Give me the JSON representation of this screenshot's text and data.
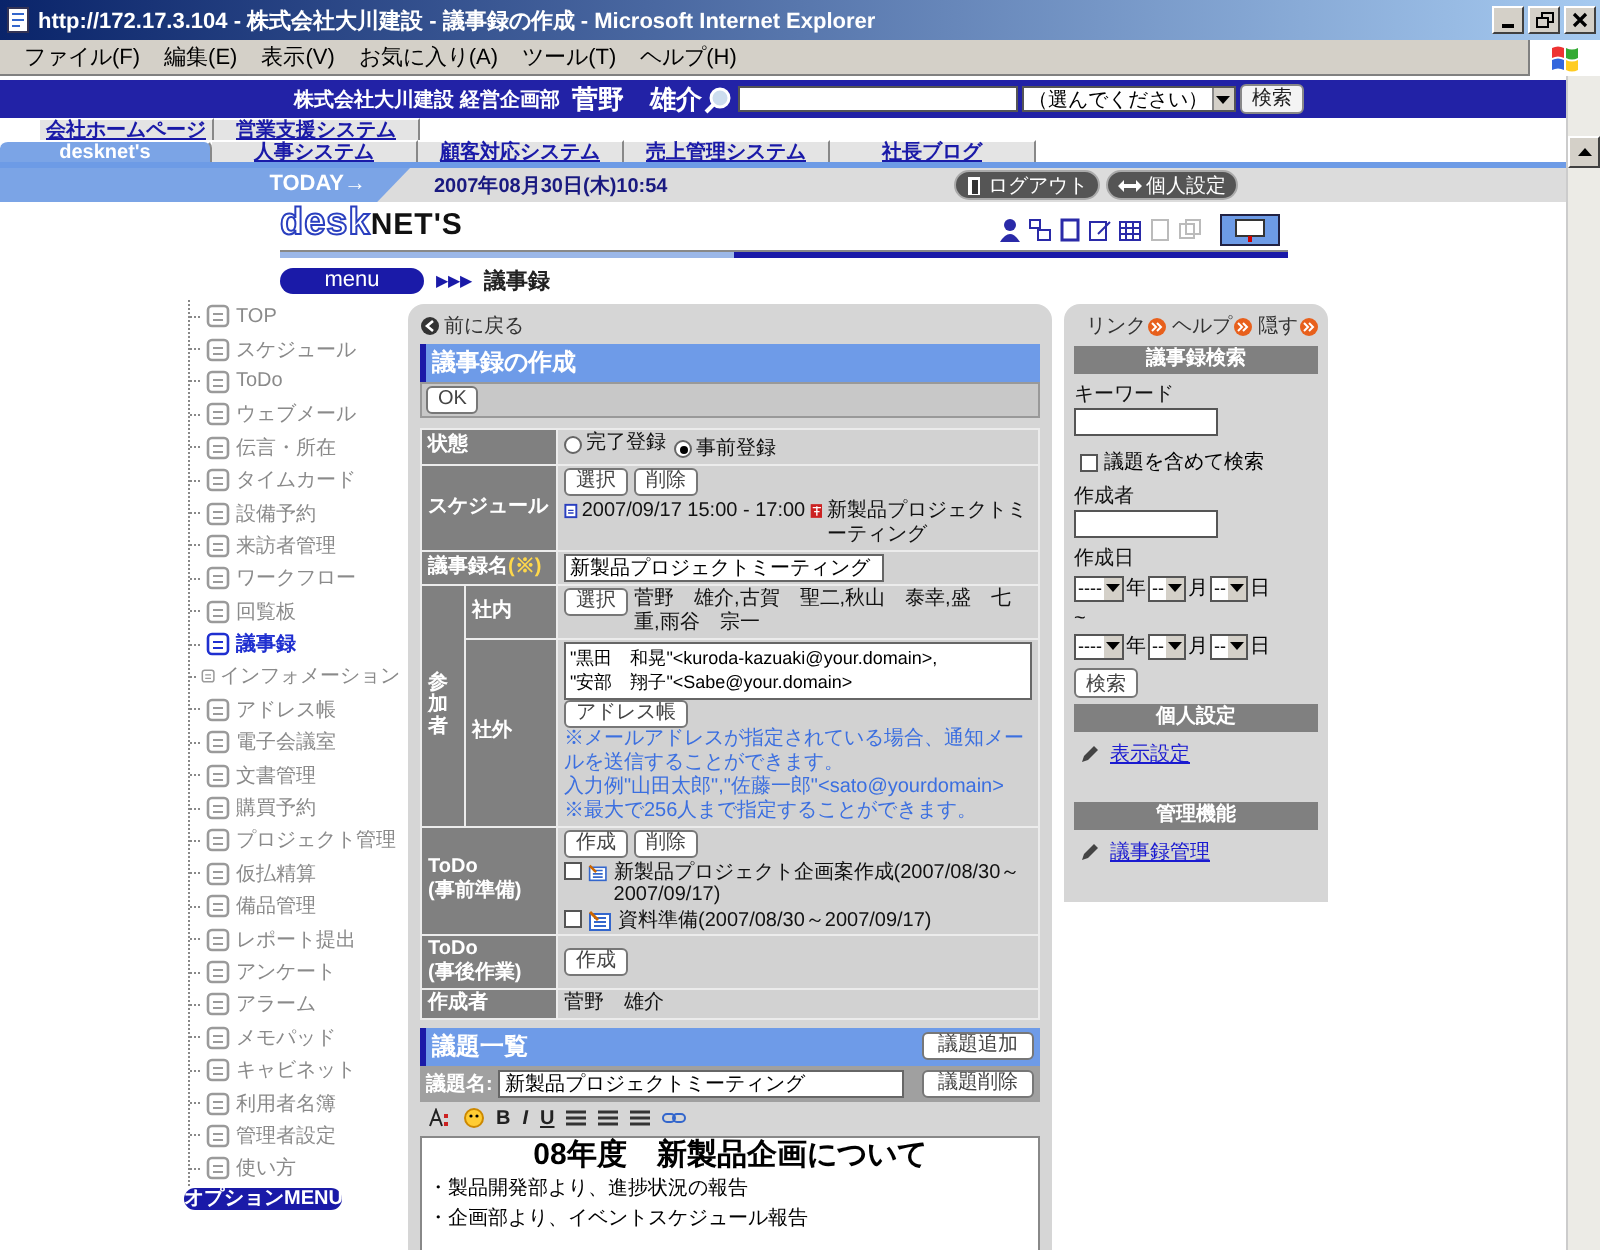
{
  "window": {
    "title": "http://172.17.3.104 - 株式会社大川建設 - 議事録の作成 - Microsoft Internet Explorer"
  },
  "menu_bar": [
    "ファイル(F)",
    "編集(E)",
    "表示(V)",
    "お気に入り(A)",
    "ツール(T)",
    "ヘルプ(H)"
  ],
  "header": {
    "company": "株式会社大川建設 経営企画部",
    "user": "菅野　雄介",
    "search_select": "（選んでください）",
    "search_button": "検索"
  },
  "tabs_top": [
    {
      "label": "会社ホームページ",
      "selected": false
    },
    {
      "label": "営業支援システム",
      "selected": false
    }
  ],
  "tabs_bottom": [
    {
      "label": "desknet's",
      "selected": true
    },
    {
      "label": "人事システム",
      "selected": false
    },
    {
      "label": "顧客対応システム",
      "selected": false
    },
    {
      "label": "売上管理システム",
      "selected": false
    },
    {
      "label": "社長ブログ",
      "selected": false
    }
  ],
  "today": {
    "label": "TODAY→",
    "date": "2007年08月30日(木)10:54",
    "logout": "ログアウト",
    "settings": "個人設定"
  },
  "logo": [
    "desk",
    "NET'S"
  ],
  "breadcrumb": {
    "menu": "menu",
    "arrows": "▶▶▶",
    "page": "議事録"
  },
  "sidebar": {
    "items": [
      {
        "label": "TOP",
        "selected": false
      },
      {
        "label": "スケジュール",
        "selected": false
      },
      {
        "label": "ToDo",
        "selected": false
      },
      {
        "label": "ウェブメール",
        "selected": false
      },
      {
        "label": "伝言・所在",
        "selected": false
      },
      {
        "label": "タイムカード",
        "selected": false
      },
      {
        "label": "設備予約",
        "selected": false
      },
      {
        "label": "来訪者管理",
        "selected": false
      },
      {
        "label": "ワークフロー",
        "selected": false
      },
      {
        "label": "回覧板",
        "selected": false
      },
      {
        "label": "議事録",
        "selected": true
      },
      {
        "label": "インフォメーション",
        "selected": false
      },
      {
        "label": "アドレス帳",
        "selected": false
      },
      {
        "label": "電子会議室",
        "selected": false
      },
      {
        "label": "文書管理",
        "selected": false
      },
      {
        "label": "購買予約",
        "selected": false
      },
      {
        "label": "プロジェクト管理",
        "selected": false
      },
      {
        "label": "仮払精算",
        "selected": false
      },
      {
        "label": "備品管理",
        "selected": false
      },
      {
        "label": "レポート提出",
        "selected": false
      },
      {
        "label": "アンケート",
        "selected": false
      },
      {
        "label": "アラーム",
        "selected": false
      },
      {
        "label": "メモパッド",
        "selected": false
      },
      {
        "label": "キャビネット",
        "selected": false
      },
      {
        "label": "利用者名簿",
        "selected": false
      },
      {
        "label": "管理者設定",
        "selected": false
      },
      {
        "label": "使い方",
        "selected": false
      }
    ],
    "option_menu": "オプションMENU"
  },
  "form": {
    "back": "前に戻る",
    "title": "議事録の作成",
    "ok": "OK",
    "status": {
      "label": "状態",
      "options": [
        {
          "label": "完了登録",
          "selected": false
        },
        {
          "label": "事前登録",
          "selected": true
        }
      ]
    },
    "schedule": {
      "label": "スケジュール",
      "buttons": [
        "選択",
        "削除"
      ],
      "time": "2007/09/17 15:00 - 17:00",
      "name": "新製品プロジェクトミーティング"
    },
    "name": {
      "label": "議事録名",
      "required": "(※)",
      "value": "新製品プロジェクトミーティング"
    },
    "participants": {
      "label": "参加者",
      "internal": {
        "label": "社内",
        "button": "選択",
        "names": "菅野　雄介,古賀　聖二,秋山　泰幸,盛　七重,雨谷　宗一"
      },
      "external": {
        "label": "社外",
        "value": "\"黒田　和晃\"<kuroda-kazuaki@your.domain>,\n\"安部　翔子\"<Sabe@your.domain>",
        "button": "アドレス帳",
        "notes": [
          "※メールアドレスが指定されている場合、通知メールを送信することができます。",
          "入力例\"山田太郎\",\"佐藤一郎\"<sato@yourdomain>",
          "※最大で256人まで指定することができます。"
        ]
      }
    },
    "todo_before": {
      "label": [
        "ToDo",
        "(事前準備)"
      ],
      "buttons": [
        "作成",
        "削除"
      ],
      "items": [
        {
          "text": "新製品プロジェクト企画案作成(2007/08/30～2007/09/17)",
          "checked": false
        },
        {
          "text": "資料準備(2007/08/30～2007/09/17)",
          "checked": false
        }
      ]
    },
    "todo_after": {
      "label": [
        "ToDo",
        "(事後作業)"
      ],
      "buttons": [
        "作成"
      ]
    },
    "author": {
      "label": "作成者",
      "value": "菅野　雄介"
    }
  },
  "agenda": {
    "title": "議題一覧",
    "add_button": "議題追加",
    "name_label": "議題名:",
    "name_value": "新製品プロジェクトミーティング",
    "delete_button": "議題削除",
    "toolbar": [
      "B",
      "I",
      "U"
    ],
    "heading": "08年度　新製品企画について",
    "lines": [
      "・製品開発部より、進捗状況の報告",
      "・企画部より、イベントスケジュール報告"
    ]
  },
  "right_panel": {
    "links": [
      "リンク",
      "ヘルプ",
      "隠す"
    ],
    "search": {
      "title": "議事録検索",
      "keyword_label": "キーワード",
      "include_label": "議題を含めて検索",
      "include_checked": false,
      "author_label": "作成者",
      "date_label": "作成日",
      "date_rows": [
        [
          {
            "value": "----",
            "unit": "年"
          },
          {
            "value": "--",
            "unit": "月"
          },
          {
            "value": "--",
            "unit": "日"
          }
        ],
        [
          {
            "value": "----",
            "unit": "年"
          },
          {
            "value": "--",
            "unit": "月"
          },
          {
            "value": "--",
            "unit": "日"
          }
        ]
      ],
      "range": "~",
      "button": "検索"
    },
    "personal": {
      "title": "個人設定",
      "link": "表示設定"
    },
    "admin": {
      "title": "管理機能",
      "link": "議事録管理"
    }
  }
}
